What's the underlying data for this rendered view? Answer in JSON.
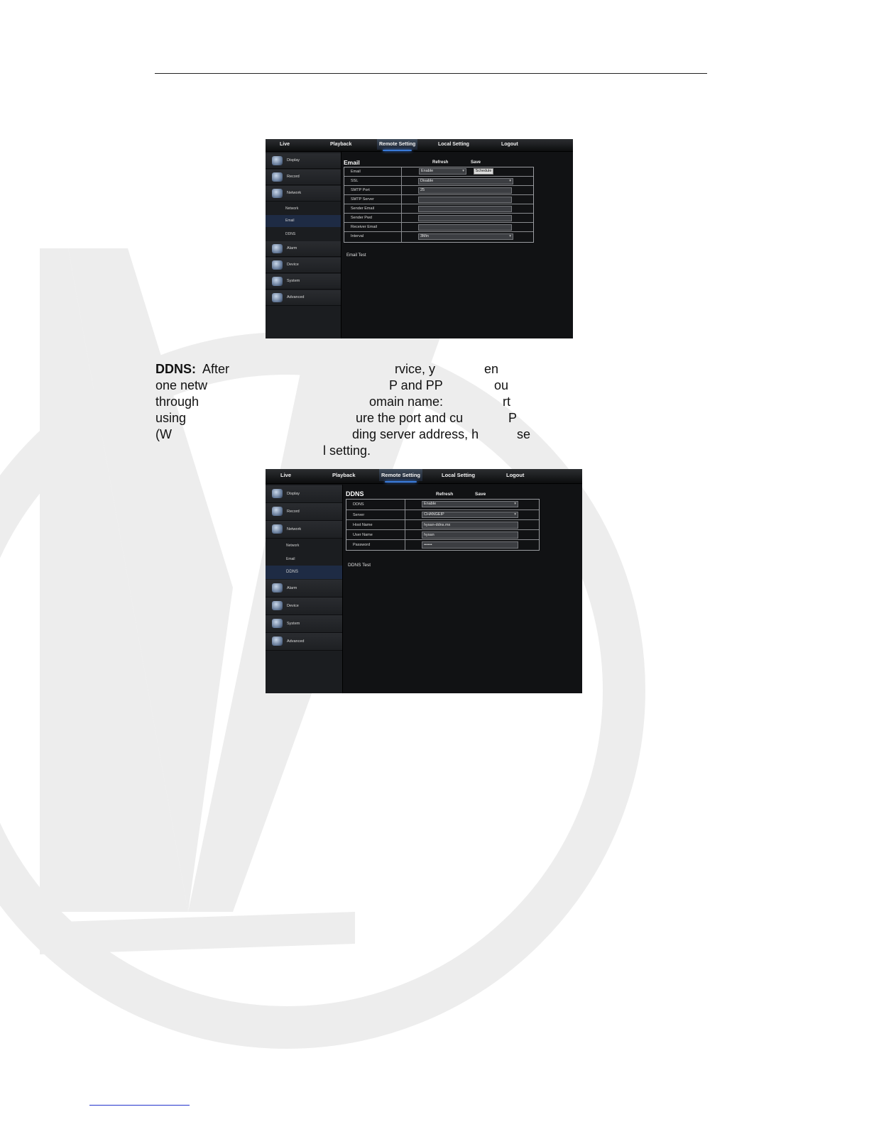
{
  "watermark": {
    "color": "#ededed"
  },
  "shot1": {
    "tabs": [
      "Live",
      "Playback",
      "Remote Setting",
      "Local Setting",
      "Logout"
    ],
    "active_tab": "Remote Setting",
    "menu": [
      "Display",
      "Record",
      "Network",
      "Alarm",
      "Device",
      "System",
      "Advanced"
    ],
    "submenu": [
      "Network",
      "Email",
      "DDNS"
    ],
    "selected_submenu": "Email",
    "panel": {
      "title": "Email",
      "refresh": "Refresh",
      "save": "Save",
      "fields": [
        {
          "label": "Email",
          "value": "Enable",
          "type": "select"
        },
        {
          "label": "SSL",
          "value": "Disable",
          "type": "select"
        },
        {
          "label": "SMTP Port",
          "value": "25",
          "type": "input"
        },
        {
          "label": "SMTP Server",
          "value": "",
          "type": "input"
        },
        {
          "label": "Sender Email",
          "value": "",
          "type": "input"
        },
        {
          "label": "Sender Pwd",
          "value": "",
          "type": "input"
        },
        {
          "label": "Receiver Email",
          "value": "",
          "type": "input"
        },
        {
          "label": "Interval",
          "value": "3Min",
          "type": "select"
        }
      ],
      "schedule_button": "Schedule",
      "test_link": "Email Test"
    }
  },
  "paragraph": {
    "line1": {
      "bold": "DDNS:",
      "a": "After",
      "b": "rvice, y",
      "c": "en"
    },
    "line2": {
      "a": "one netw",
      "b": "P and PP",
      "c": "ou"
    },
    "line3": {
      "a": "through",
      "b": "omain name:",
      "c": "rt"
    },
    "line4": {
      "a": "using",
      "b": "ure the port and cu",
      "c": "P"
    },
    "line5": {
      "a": "(W",
      "b": "ding server address, h",
      "c": "se"
    },
    "line6": {
      "a": "l setting."
    }
  },
  "shot2": {
    "tabs": [
      "Live",
      "Playback",
      "Remote Setting",
      "Local Setting",
      "Logout"
    ],
    "active_tab": "Remote Setting",
    "menu": [
      "Display",
      "Record",
      "Network",
      "Alarm",
      "Device",
      "System",
      "Advanced"
    ],
    "submenu": [
      "Network",
      "Email",
      "DDNS"
    ],
    "selected_submenu": "DDNS",
    "panel": {
      "title": "DDNS",
      "refresh": "Refresh",
      "save": "Save",
      "fields": [
        {
          "label": "DDNS",
          "value": "Enable",
          "type": "select"
        },
        {
          "label": "Server",
          "value": "CHANGEIP",
          "type": "select"
        },
        {
          "label": "Host Name",
          "value": "hysan-ddns.mx",
          "type": "input"
        },
        {
          "label": "User Name",
          "value": "hysan",
          "type": "input"
        },
        {
          "label": "Password",
          "value": "••••••",
          "type": "input"
        }
      ],
      "test_link": "DDNS Test"
    }
  }
}
